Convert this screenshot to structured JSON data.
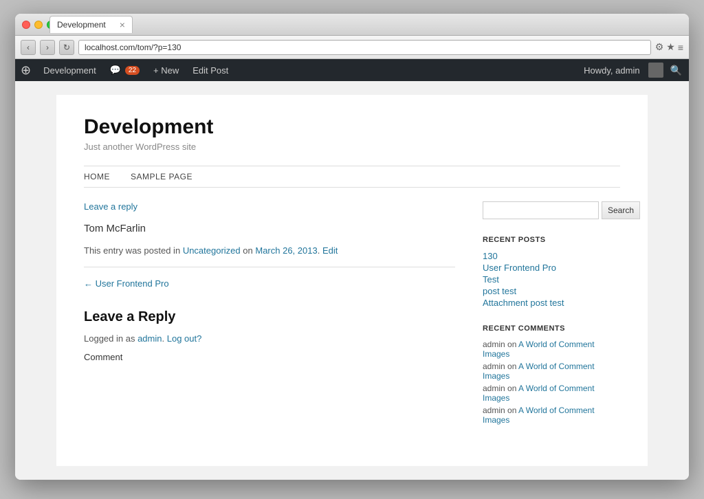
{
  "browser": {
    "tab_title": "Development",
    "url": "localhost.com/tom/?p=130",
    "back_btn": "‹",
    "forward_btn": "›",
    "refresh_btn": "↻"
  },
  "admin_bar": {
    "wp_label": "W",
    "site_name": "Development",
    "comments_label": "22",
    "new_label": "+ New",
    "edit_post_label": "Edit Post",
    "howdy_label": "Howdy, admin",
    "search_icon": "🔍"
  },
  "site": {
    "title": "Development",
    "tagline": "Just another WordPress site",
    "nav": {
      "home": "HOME",
      "sample_page": "SAMPLE PAGE"
    }
  },
  "post": {
    "leave_reply_link": "Leave a reply",
    "author": "Tom McFarlin",
    "meta_text": "This entry was posted in",
    "category": "Uncategorized",
    "meta_on": "on",
    "date": "March 26, 2013",
    "edit_label": "Edit",
    "prev_post_link": "← User Frontend Pro",
    "leave_reply_heading": "Leave a Reply",
    "logged_in_prefix": "Logged in as",
    "logged_in_user": "admin",
    "log_out_link": "Log out?",
    "comment_label": "Comment"
  },
  "sidebar": {
    "search_placeholder": "",
    "search_button": "Search",
    "recent_posts_title": "RECENT POSTS",
    "recent_posts": [
      {
        "title": "130"
      },
      {
        "title": "User Frontend Pro"
      },
      {
        "title": "Test"
      },
      {
        "title": "post test"
      },
      {
        "title": "Attachment post test"
      }
    ],
    "recent_comments_title": "RECENT COMMENTS",
    "recent_comments": [
      {
        "text": "admin on",
        "link": "A World of Comment Images"
      },
      {
        "text": "admin on",
        "link": "A World of Comment Images"
      },
      {
        "text": "admin on",
        "link": "A World of Comment Images"
      },
      {
        "text": "admin on",
        "link": "A World of Comment Images"
      }
    ]
  }
}
